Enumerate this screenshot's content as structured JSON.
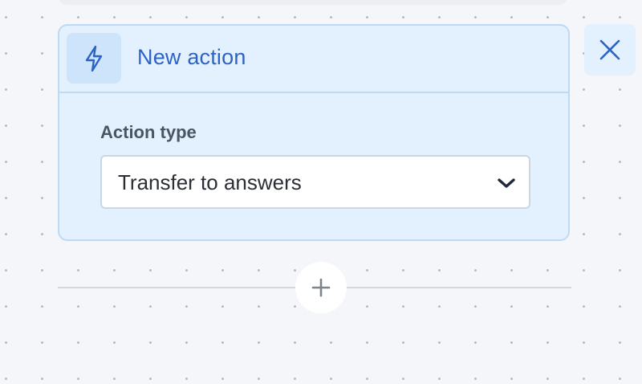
{
  "action_card": {
    "title": "New action",
    "icon": "lightning-bolt-icon",
    "field_label": "Action type",
    "select_value": "Transfer to answers",
    "select_icon": "chevron-down-icon"
  },
  "close_button": {
    "icon": "close-icon"
  },
  "add_step_button": {
    "icon": "plus-icon"
  },
  "colors": {
    "accent": "#2d63c3",
    "card_background": "#e3f0fd",
    "card_border": "#bcdaf5",
    "canvas_background": "#f4f6f9"
  }
}
